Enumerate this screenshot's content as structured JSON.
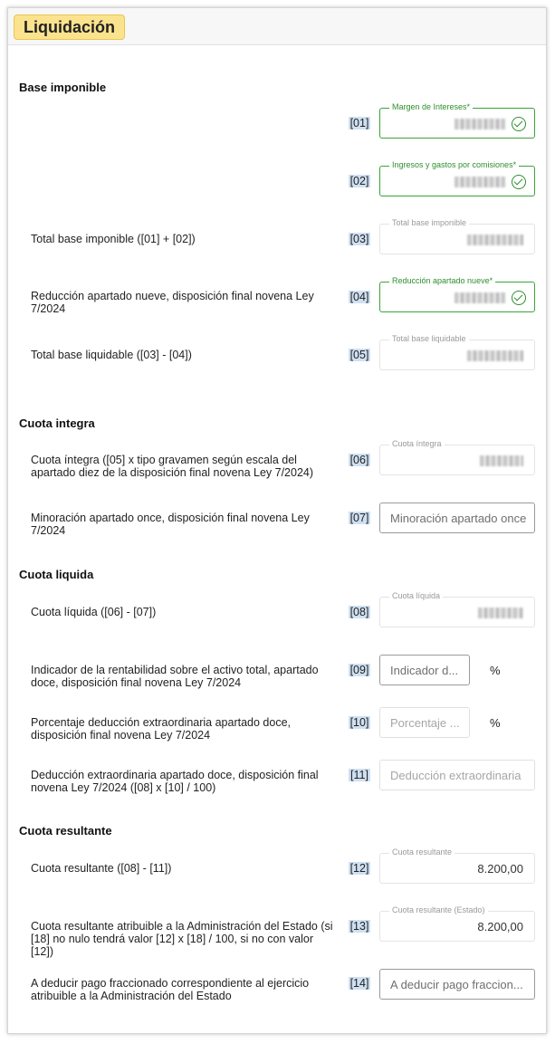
{
  "title": "Liquidación",
  "sections": {
    "base": "Base imponible",
    "integra": "Cuota integra",
    "liquida": "Cuota liquida",
    "resultante": "Cuota resultante"
  },
  "rows": {
    "r01": {
      "code": "[01]",
      "label": "",
      "field_label": "Margen de Intereses*"
    },
    "r02": {
      "code": "[02]",
      "label": "",
      "field_label": "Ingresos y gastos por comisiones*"
    },
    "r03": {
      "code": "[03]",
      "label": "Total base imponible ([01] + [02])",
      "field_label": "Total base imponible"
    },
    "r04": {
      "code": "[04]",
      "label": "Reducción apartado nueve, disposición final novena Ley 7/2024",
      "field_label": "Reducción apartado nueve*"
    },
    "r05": {
      "code": "[05]",
      "label": "Total base liquidable ([03] - [04])",
      "field_label": "Total base liquidable"
    },
    "r06": {
      "code": "[06]",
      "label": "Cuota íntegra ([05] x tipo gravamen según escala del apartado diez de la disposición final novena Ley 7/2024)",
      "field_label": "Cuota íntegra"
    },
    "r07": {
      "code": "[07]",
      "label": "Minoración apartado once, disposición final novena Ley 7/2024",
      "placeholder": "Minoración apartado once"
    },
    "r08": {
      "code": "[08]",
      "label": "Cuota líquida ([06] - [07])",
      "field_label": "Cuota líquida"
    },
    "r09": {
      "code": "[09]",
      "label": "Indicador de la rentabilidad sobre el activo total, apartado doce, disposición final novena Ley 7/2024",
      "placeholder": "Indicador d...",
      "unit": "%"
    },
    "r10": {
      "code": "[10]",
      "label": "Porcentaje deducción extraordinaria apartado doce, disposición final novena Ley 7/2024",
      "placeholder": "Porcentaje ...",
      "unit": "%"
    },
    "r11": {
      "code": "[11]",
      "label": "Deducción extraordinaria apartado doce, disposición final novena Ley 7/2024 ([08] x [10] / 100)",
      "placeholder": "Deducción extraordinaria"
    },
    "r12": {
      "code": "[12]",
      "label": "Cuota resultante ([08] - [11])",
      "field_label": "Cuota resultante",
      "value": "8.200,00"
    },
    "r13": {
      "code": "[13]",
      "label": "Cuota resultante atribuible a la Administración del Estado (si [18] no nulo tendrá valor [12] x [18] / 100, si no con valor [12])",
      "field_label": "Cuota resultante (Estado)",
      "value": "8.200,00"
    },
    "r14": {
      "code": "[14]",
      "label": "A deducir pago fraccionado correspondiente al ejercicio atribuible a la Administración del Estado",
      "placeholder": "A deducir pago fraccion..."
    }
  },
  "colors": {
    "accent_yellow": "#fbe38e",
    "valid_green": "#3aa33a",
    "code_highlight": "#cfe0f2"
  }
}
